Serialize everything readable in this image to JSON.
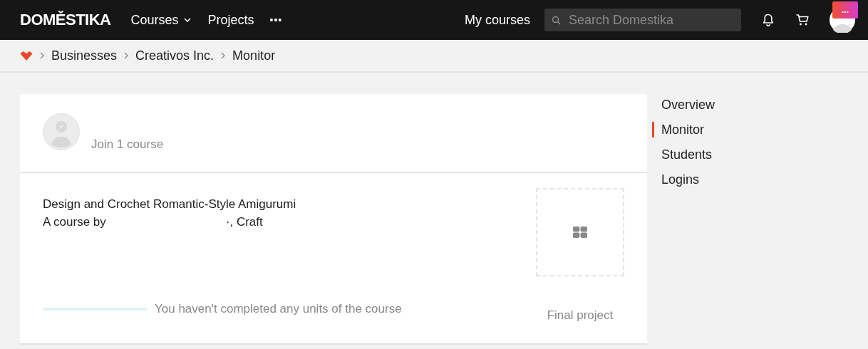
{
  "nav": {
    "logo": "DOMĚSTIKA",
    "items": [
      {
        "label": "Courses",
        "dropdown": true
      },
      {
        "label": "Projects",
        "dropdown": false
      }
    ],
    "more": "•••",
    "my_courses": "My courses",
    "search": {
      "placeholder": "Search Domestika"
    },
    "avatar_badge": "..."
  },
  "breadcrumb": [
    "Businesses",
    "Creativos Inc.",
    "Monitor"
  ],
  "card": {
    "header": "Join 1 course",
    "course": {
      "title": "Design and Crochet Romantic-Style Amigurumi",
      "byline_start": "A course by",
      "byline_end": "·, Craft",
      "level": 0,
      "progress_text": "You haven't completed any units of the course",
      "final_project": "Final project"
    }
  },
  "sidebar": {
    "items": [
      {
        "label": "Overview",
        "selected": false
      },
      {
        "label": "Monitor",
        "selected": true
      },
      {
        "label": "Students",
        "selected": false
      },
      {
        "label": "Logins",
        "selected": false
      }
    ]
  }
}
